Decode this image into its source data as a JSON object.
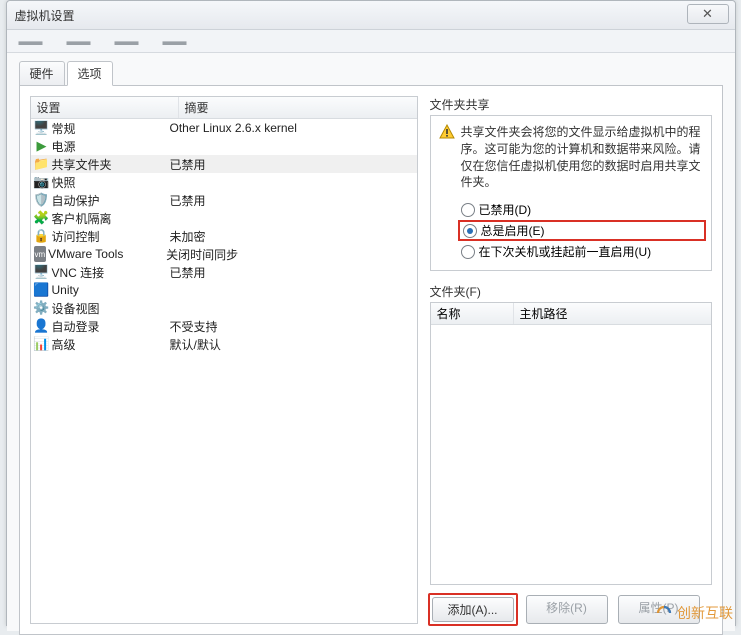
{
  "window": {
    "title": "虚拟机设置"
  },
  "tabs": {
    "hardware": "硬件",
    "options": "选项"
  },
  "left": {
    "header_settings": "设置",
    "header_summary": "摘要",
    "rows": [
      {
        "name": "常规",
        "summary": "Other Linux 2.6.x kernel"
      },
      {
        "name": "电源",
        "summary": ""
      },
      {
        "name": "共享文件夹",
        "summary": "已禁用"
      },
      {
        "name": "快照",
        "summary": ""
      },
      {
        "name": "自动保护",
        "summary": "已禁用"
      },
      {
        "name": "客户机隔离",
        "summary": ""
      },
      {
        "name": "访问控制",
        "summary": "未加密"
      },
      {
        "name": "VMware Tools",
        "summary": "关闭时间同步"
      },
      {
        "name": "VNC 连接",
        "summary": "已禁用"
      },
      {
        "name": "Unity",
        "summary": ""
      },
      {
        "name": "设备视图",
        "summary": ""
      },
      {
        "name": "自动登录",
        "summary": "不受支持"
      },
      {
        "name": "高级",
        "summary": "默认/默认"
      }
    ]
  },
  "right": {
    "group1_label": "文件夹共享",
    "warning": "共享文件夹会将您的文件显示给虚拟机中的程序。这可能为您的计算机和数据带来风险。请仅在您信任虚拟机使用您的数据时启用共享文件夹。",
    "radio_disabled": "已禁用(D)",
    "radio_always": "总是启用(E)",
    "radio_until": "在下次关机或挂起前一直启用(U)",
    "group2_label": "文件夹(F)",
    "col_name": "名称",
    "col_path": "主机路径",
    "btn_add": "添加(A)...",
    "btn_remove": "移除(R)",
    "btn_props": "属性(P)"
  },
  "watermark": "创新互联"
}
